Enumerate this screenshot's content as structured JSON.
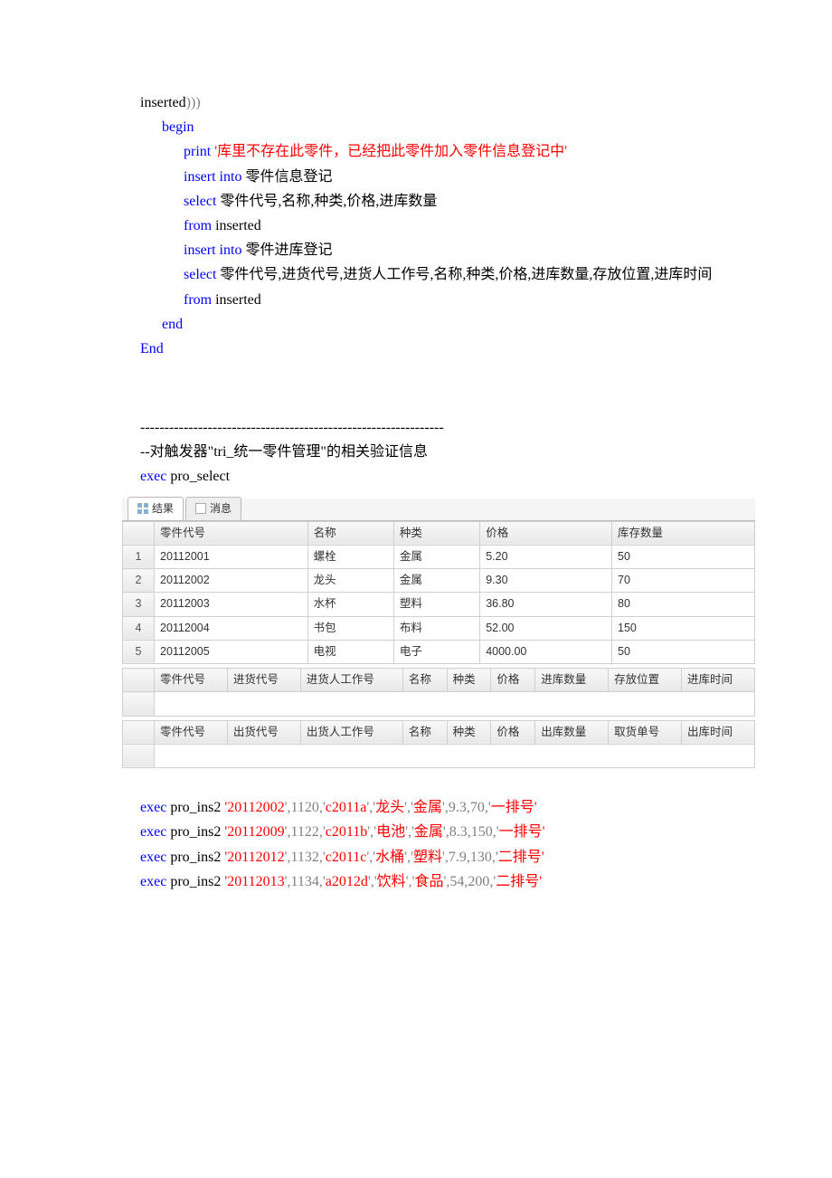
{
  "sql_top": {
    "line1_a": "inserted",
    "line1_b": ")))",
    "begin": "begin",
    "print_kw": "print",
    "print_q": "'",
    "print_msg": "库里不存在此零件，已经把此零件加入零件信息登记中",
    "ins1_a": "insert",
    "ins1_b": " into",
    "ins1_t": "  零件信息登记",
    "sel1_a": "select",
    "sel1_cols": "  零件代号,名称,种类,价格,进库数量",
    "from1_a": "from",
    "from1_b": " inserted",
    "ins2_a": "insert",
    "ins2_b": " into",
    "ins2_t": "  零件进库登记",
    "sel2_a": "select",
    "sel2_cols": "  零件代号,进货代号,进货人工作号,名称,种类,价格,进库数量,存放位置,进库时间",
    "from2_a": "from",
    "from2_b": " inserted",
    "end": "end",
    "End": "End"
  },
  "section2": {
    "sep": "---------------------------------------------------------------",
    "comment": "--对触发器\"tri_统一零件管理\"的相关验证信息",
    "exec_kw": "exec",
    "exec_name": " pro_select"
  },
  "tabs": {
    "results": "结果",
    "messages": "消息"
  },
  "table1": {
    "headers": [
      "",
      "零件代号",
      "名称",
      "种类",
      "价格",
      "库存数量"
    ],
    "rows": [
      [
        "1",
        "20112001",
        "螺栓",
        "金属",
        "5.20",
        "50"
      ],
      [
        "2",
        "20112002",
        "龙头",
        "金属",
        "9.30",
        "70"
      ],
      [
        "3",
        "20112003",
        "水杯",
        "塑料",
        "36.80",
        "80"
      ],
      [
        "4",
        "20112004",
        "书包",
        "布料",
        "52.00",
        "150"
      ],
      [
        "5",
        "20112005",
        "电视",
        "电子",
        "4000.00",
        "50"
      ]
    ]
  },
  "table2_headers": [
    "",
    "零件代号",
    "进货代号",
    "进货人工作号",
    "名称",
    "种类",
    "价格",
    "进库数量",
    "存放位置",
    "进库时间"
  ],
  "table3_headers": [
    "",
    "零件代号",
    "出货代号",
    "出货人工作号",
    "名称",
    "种类",
    "价格",
    "出库数量",
    "取货单号",
    "出库时间"
  ],
  "execs": [
    {
      "kw": "exec",
      "name": " pro_ins2 ",
      "q": "'",
      "p1": "20112002",
      "c": "',1120,'",
      "p2": "c2011a",
      "m1": "','",
      "a1": "龙头",
      "a2": "金属",
      "rest": "',9.3,70,'",
      "loc": "一排号",
      "end": "'"
    },
    {
      "kw": "exec",
      "name": " pro_ins2 ",
      "q": "'",
      "p1": "20112009",
      "c": "',1122,'",
      "p2": "c2011b",
      "m1": "','",
      "a1": "电池",
      "a2": "金属",
      "rest": "',8.3,150,'",
      "loc": "一排号",
      "end": "'"
    },
    {
      "kw": "exec",
      "name": " pro_ins2 ",
      "q": "'",
      "p1": "20112012",
      "c": "',1132,'",
      "p2": "c2011c",
      "m1": "','",
      "a1": "水桶",
      "a2": "塑料",
      "rest": "',7.9,130,'",
      "loc": "二排号",
      "end": "'"
    },
    {
      "kw": "exec",
      "name": " pro_ins2 ",
      "q": "'",
      "p1": "20112013",
      "c": "',1134,'",
      "p2": "a2012d",
      "m1": "','",
      "a1": "饮料",
      "a2": "食品",
      "rest": "',54,200,'",
      "loc": "二排号",
      "end": "'"
    }
  ]
}
